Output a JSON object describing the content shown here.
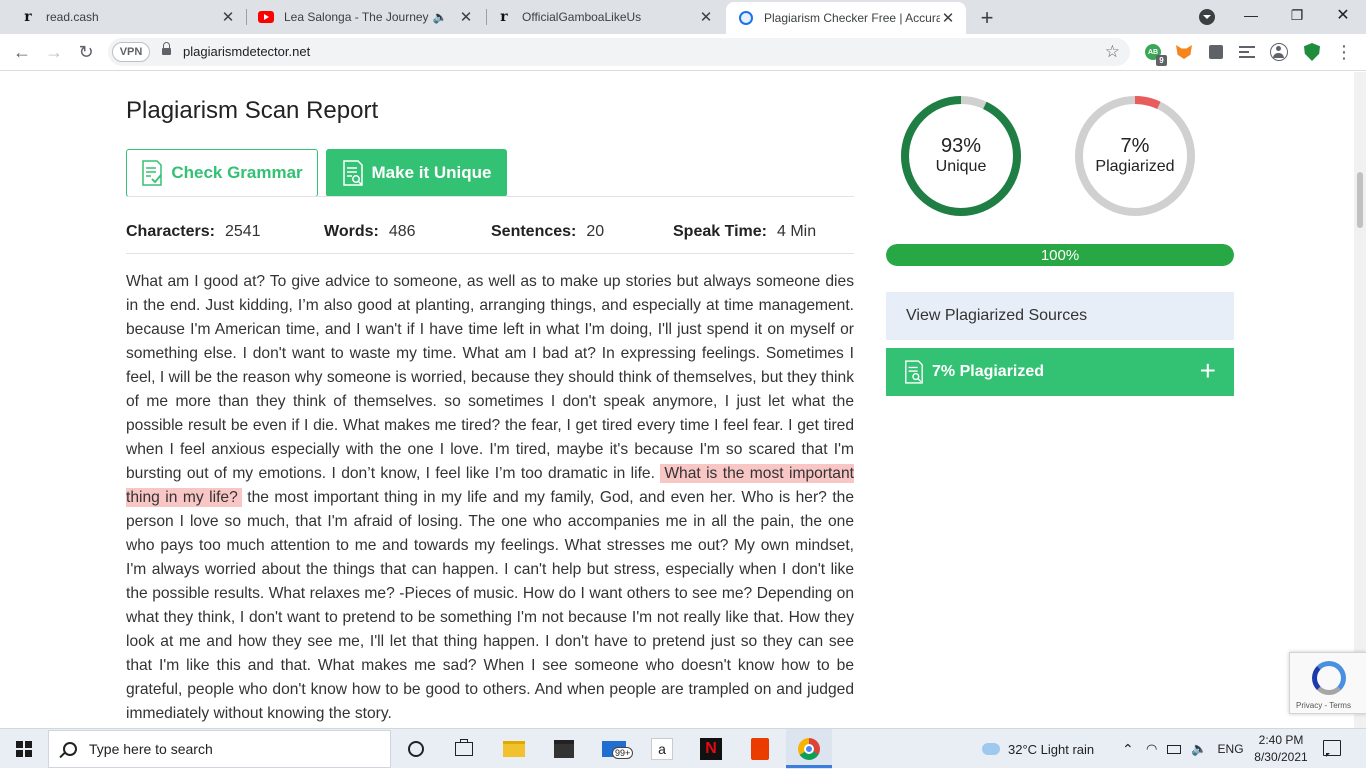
{
  "browser": {
    "tabs": [
      {
        "title": "read.cash",
        "icon": "read-cash-icon"
      },
      {
        "title": "Lea Salonga - The Journey | L",
        "icon": "youtube-icon"
      },
      {
        "title": "OfficialGamboaLikeUs",
        "icon": "read-cash-icon"
      },
      {
        "title": "Plagiarism Checker Free | Accurat",
        "icon": "plagiarism-detector-icon",
        "active": true
      }
    ],
    "new_tab": "+",
    "url": "plagiarismdetector.net",
    "vpn_label": "VPN",
    "extension_badge": "9",
    "ab_label": "AB",
    "back": "←",
    "forward": "→",
    "reload": "↻",
    "star": "☆",
    "menu": "⋮",
    "minimize": "—",
    "maximize": "❐",
    "close": "✕",
    "tab_close": "✕"
  },
  "report": {
    "title": "Plagiarism Scan Report",
    "check_grammar": "Check Grammar",
    "make_unique": "Make it Unique",
    "stats": [
      {
        "label": "Characters:",
        "value": "2541"
      },
      {
        "label": "Words:",
        "value": "486"
      },
      {
        "label": "Sentences:",
        "value": "20"
      },
      {
        "label": "Speak Time:",
        "value": "4 Min"
      }
    ],
    "text_before": "What am I good at? To give advice to someone, as well as to make up stories but always someone dies in the end. Just kidding, I’m also good at planting, arranging things, and especially at time management. because I'm American time, and I wan't if I have time left in what I'm doing, I'll just spend it on myself or something else. I don't want to waste my time. What am I bad at? In expressing feelings. Sometimes I feel, I will be the reason why someone is worried, because they should think of themselves, but they think of me more than they think of themselves. so sometimes I don't speak anymore, I just let what the possible result be even if I die. What makes me tired? the fear, I get tired every time I feel fear. I get tired when I feel anxious especially with the one I love. I'm tired, maybe it's because I'm so scared that I'm bursting out of my emotions. I don’t know, I feel like I’m too dramatic in life.",
    "highlighted": "What is the most important thing in my life?",
    "text_after": "the most important thing in my life and my family, God, and even her. Who is her? the person I love so much, that I'm afraid of losing. The one who accompanies me in all the pain, the one who pays too much attention to me and towards my feelings. What stresses me out? My own mindset, I'm always worried about the things that can happen. I can't help but stress, especially when I don't like the possible results. What relaxes me? -Pieces of music. How do I want others to see me? Depending on what they think, I don't want to pretend to be something I'm not because I'm not really like that. How they look at me and how they see me, I'll let that thing happen. I don't have to pretend just so they can see that I'm like this and that. What makes me sad? When I see someone who doesn't know how to be grateful, people who don't know how to be good to others. And when people are trampled on and judged immediately without knowing the story."
  },
  "results": {
    "unique_pct": "93%",
    "unique_label": "Unique",
    "unique_value": 0.93,
    "plag_pct": "7%",
    "plag_label": "Plagiarized",
    "plag_value": 0.07,
    "progress_label": "100%",
    "progress_value": 1.0,
    "view_sources": "View Plagiarized Sources",
    "plag_panel": "7% Plagiarized",
    "plus": "+",
    "colors": {
      "green": "#33c173",
      "dark_green": "#1e7e44",
      "red": "#e85c5c",
      "grey": "#d0d0d0",
      "progress": "#28a745"
    }
  },
  "recaptcha": {
    "terms": "Privacy - Terms"
  },
  "taskbar": {
    "search_placeholder": "Type here to search",
    "store_badge": "99+",
    "weather": "32°C  Light rain",
    "language": "ENG",
    "time": "2:40 PM",
    "date": "8/30/2021"
  }
}
